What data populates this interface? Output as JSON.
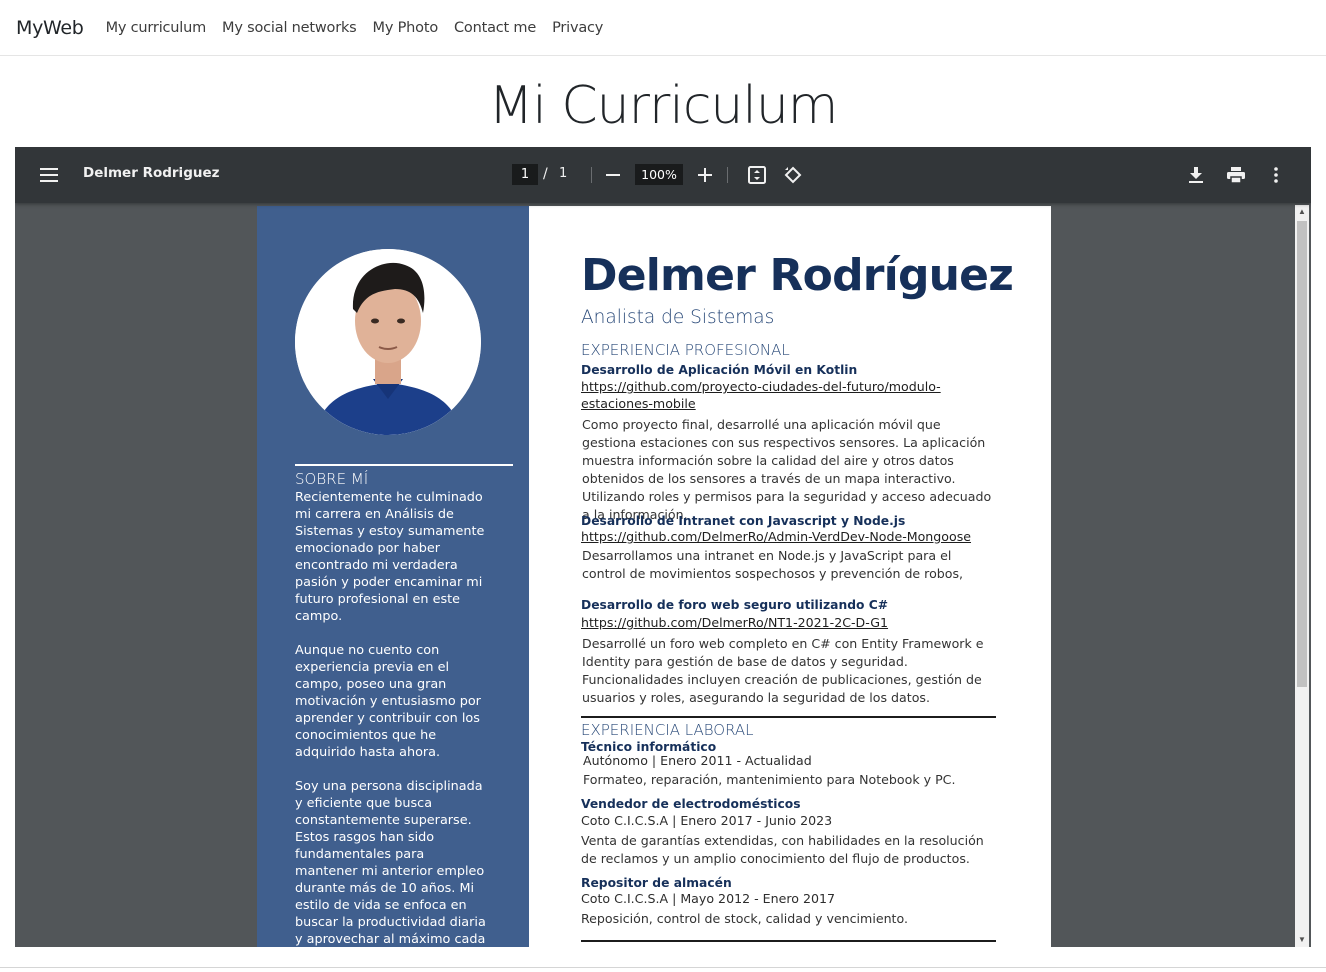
{
  "navbar": {
    "brand": "MyWeb",
    "links": [
      "My curriculum",
      "My social networks",
      "My Photo",
      "Contact me",
      "Privacy"
    ]
  },
  "page": {
    "title": "Mi Curriculum"
  },
  "viewer": {
    "doc_title": "Delmer Rodriguez",
    "current_page": "1",
    "page_separator": "/",
    "total_pages": "1",
    "zoom": "100%",
    "icons": [
      "menu-icon",
      "zoom-out-icon",
      "zoom-in-icon",
      "fit-page-icon",
      "rotate-icon",
      "download-icon",
      "print-icon",
      "more-options-icon"
    ]
  },
  "cv": {
    "name": "Delmer Rodríguez",
    "role": "Analista de Sistemas",
    "about": {
      "heading": "SOBRE MÍ",
      "paragraphs": [
        "Recientemente he culminado mi carrera en Análisis de Sistemas y estoy sumamente emocionado por haber encontrado mi verdadera pasión y poder encaminar mi futuro profesional en este campo.",
        "Aunque no cuento con experiencia previa en el campo, poseo una gran motivación y entusiasmo por aprender y contribuir con los conocimientos que he adquirido hasta ahora.",
        "Soy una persona disciplinada y eficiente que busca constantemente superarse. Estos rasgos han sido fundamentales para mantener mi anterior empleo durante más de 10 años. Mi estilo de vida se enfoca en buscar la productividad diaria y aprovechar al máximo cada"
      ]
    },
    "experience_professional": {
      "heading": "EXPERIENCIA PROFESIONAL",
      "items": [
        {
          "title": "Desarrollo de Aplicación Móvil en Kotlin",
          "link": "https://github.com/proyecto-ciudades-del-futuro/modulo-estaciones-mobile",
          "text": "Como proyecto final, desarrollé una aplicación móvil que gestiona estaciones con sus respectivos sensores. La aplicación muestra información sobre la calidad del aire y otros datos obtenidos de los sensores a través de un mapa interactivo. Utilizando roles y permisos para la seguridad y acceso adecuado a la información."
        },
        {
          "title": "Desarrollo de Intranet  con Javascript y Node.js",
          "link": "https://github.com/DelmerRo/Admin-VerdDev-Node-Mongoose",
          "text": "Desarrollamos una intranet en Node.js y JavaScript para el control de movimientos sospechosos y prevención de robos,"
        },
        {
          "title": "Desarrollo de foro web seguro utilizando C#",
          "link": "https://github.com/DelmerRo/NT1-2021-2C-D-G1",
          "text": "Desarrollé un foro web completo en C# con Entity Framework e Identity para gestión de base de datos y seguridad. Funcionalidades incluyen creación de publicaciones, gestión de usuarios y roles, asegurando la seguridad de los datos."
        }
      ]
    },
    "experience_work": {
      "heading": "EXPERIENCIA LABORAL",
      "items": [
        {
          "title": "Técnico informático",
          "meta": "Autónomo | Enero 2011 - Actualidad",
          "text": "Formateo, reparación, mantenimiento para Notebook y PC."
        },
        {
          "title": "Vendedor de electrodomésticos",
          "meta": "Coto C.I.C.S.A | Enero 2017 - Junio 2023",
          "text": "Venta de garantías extendidas, con habilidades en la resolución de reclamos y un amplio conocimiento del flujo de productos."
        },
        {
          "title": "Repositor de almacén",
          "meta": "Coto C.I.C.S.A | Mayo 2012 - Enero 2017",
          "text": "Reposición, control de stock, calidad y vencimiento."
        }
      ]
    }
  },
  "colors": {
    "sidebar": "#405f8e",
    "name": "#16305a",
    "toolbar": "#323639",
    "viewer_bg": "#525659"
  }
}
